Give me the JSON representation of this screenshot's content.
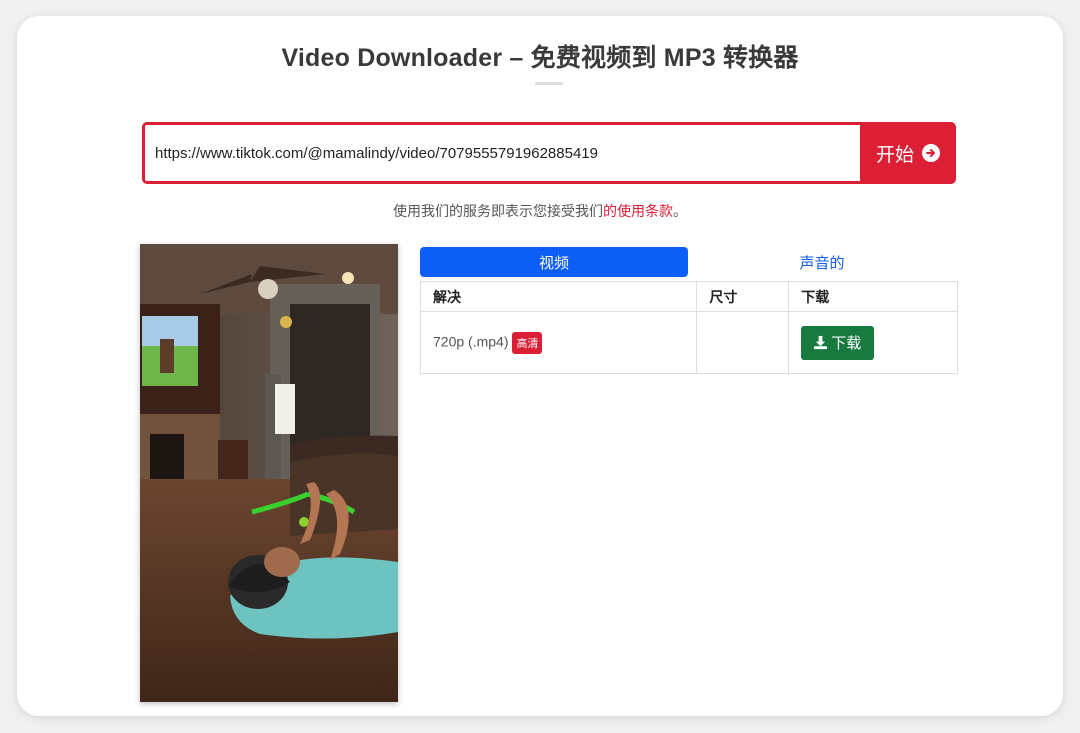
{
  "page": {
    "title": "Video Downloader – 免费视频到 MP3 转换器"
  },
  "search": {
    "url_value": "https://www.tiktok.com/@mamalindy/video/7079555791962885419",
    "button_label": "开始"
  },
  "terms": {
    "prefix": "使用我们的服务即表示您接受我们",
    "link": "的使用条款",
    "suffix": "。"
  },
  "tabs": [
    {
      "label": "视频",
      "active": true
    },
    {
      "label": "声音的",
      "active": false
    }
  ],
  "table": {
    "headers": [
      "解决",
      "尺寸",
      "下载"
    ],
    "rows": [
      {
        "resolution": "720p (.mp4)",
        "badge": "高清",
        "size": "",
        "download_label": "下载"
      }
    ]
  },
  "colors": {
    "accent_red": "#dc1f35",
    "tab_blue": "#0d5ef7",
    "download_green": "#187a3f"
  },
  "icons": {
    "start": "arrow-circle-right-icon",
    "download": "download-icon"
  }
}
